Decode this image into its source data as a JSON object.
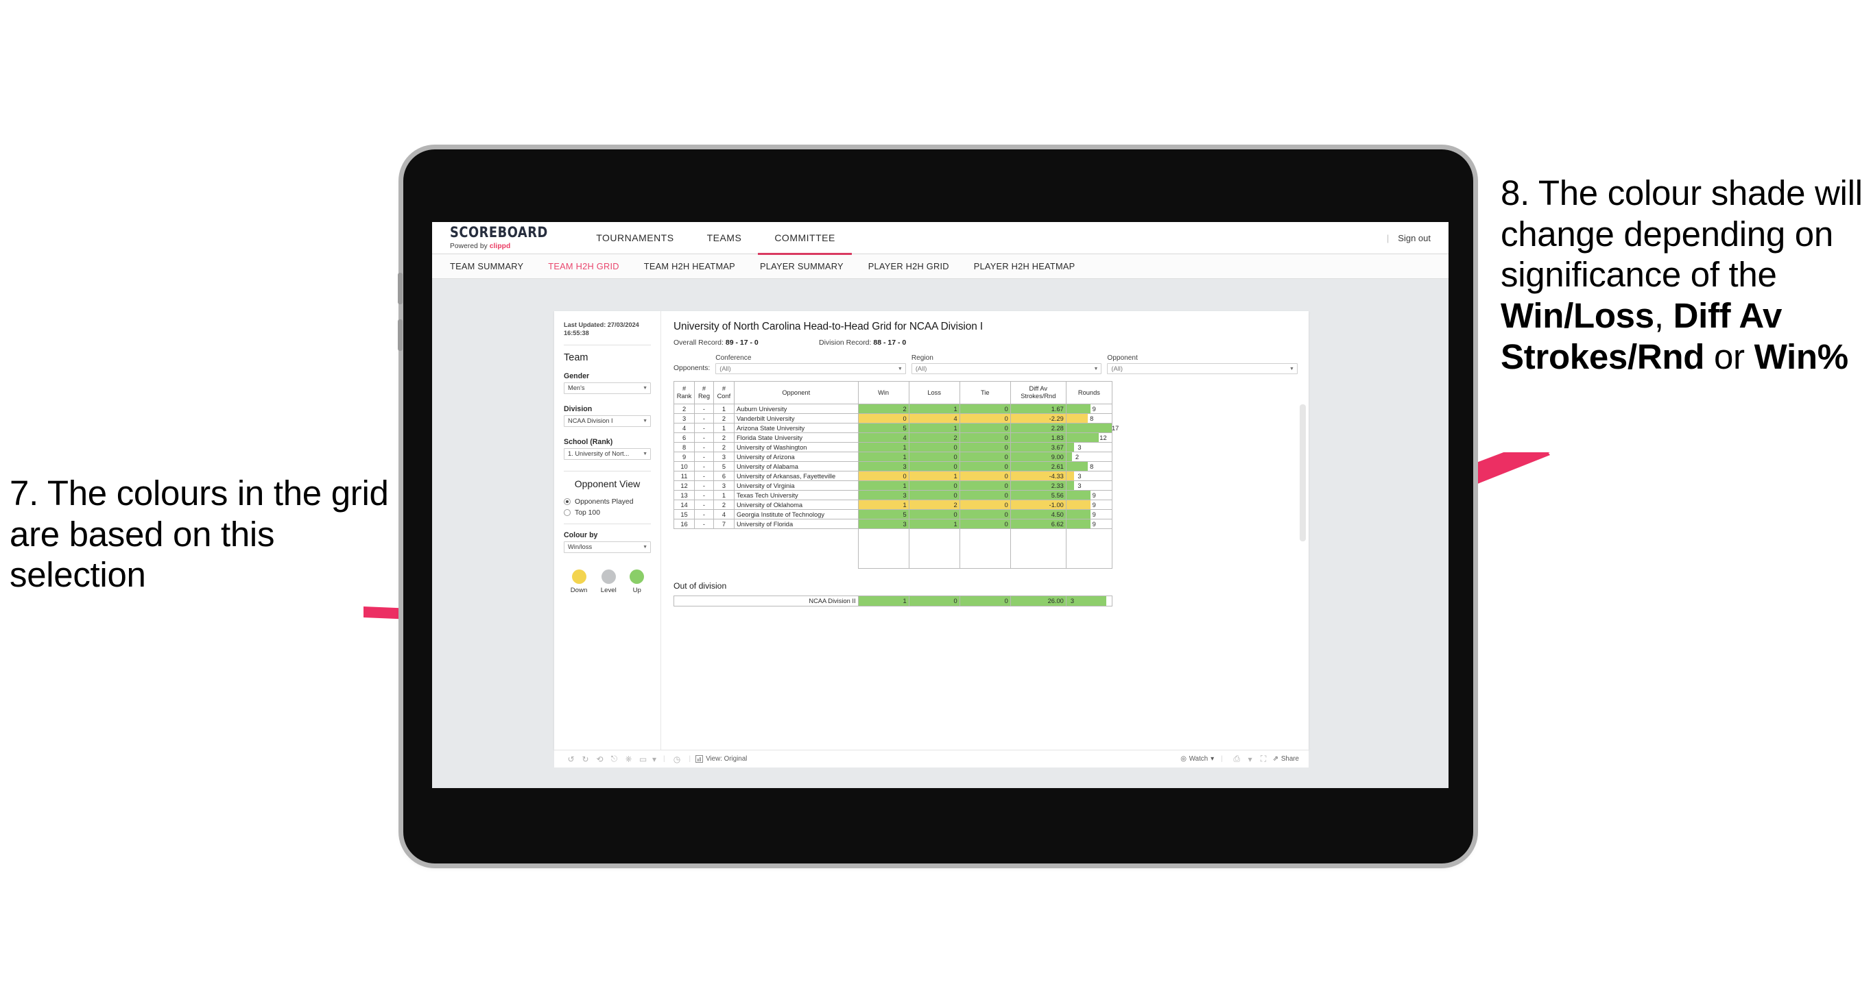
{
  "annotations": {
    "left": {
      "number": "7.",
      "text": "7. The colours in the grid are based on this selection"
    },
    "right": {
      "segments": [
        {
          "text": "8. The colour shade will change depending on significance of the ",
          "bold": false
        },
        {
          "text": "Win/Loss",
          "bold": true
        },
        {
          "text": ", ",
          "bold": false
        },
        {
          "text": "Diff Av Strokes/Rnd",
          "bold": true
        },
        {
          "text": " or ",
          "bold": false
        },
        {
          "text": "Win%",
          "bold": true
        }
      ]
    },
    "arrow_color": "#ec2f63"
  },
  "app": {
    "brand": {
      "title": "SCOREBOARD",
      "powered_prefix": "Powered by ",
      "powered_name": "clippd"
    },
    "topnav": [
      {
        "label": "TOURNAMENTS",
        "active": false
      },
      {
        "label": "TEAMS",
        "active": false
      },
      {
        "label": "COMMITTEE",
        "active": true
      }
    ],
    "signout": {
      "divider": "|",
      "label": "Sign out"
    },
    "subnav": [
      {
        "label": "TEAM SUMMARY",
        "active": false
      },
      {
        "label": "TEAM H2H GRID",
        "active": true
      },
      {
        "label": "TEAM H2H HEATMAP",
        "active": false
      },
      {
        "label": "PLAYER SUMMARY",
        "active": false
      },
      {
        "label": "PLAYER H2H GRID",
        "active": false
      },
      {
        "label": "PLAYER H2H HEATMAP",
        "active": false
      }
    ],
    "accent_color": "#e9476e"
  },
  "filters": {
    "last_updated": "Last Updated: 27/03/2024 16:55:38",
    "team_heading": "Team",
    "gender": {
      "label": "Gender",
      "value": "Men's"
    },
    "division": {
      "label": "Division",
      "value": "NCAA Division I"
    },
    "school": {
      "label": "School (Rank)",
      "value": "1. University of Nort..."
    },
    "opponent_view": {
      "heading": "Opponent View",
      "options": [
        {
          "label": "Opponents Played",
          "selected": true
        },
        {
          "label": "Top 100",
          "selected": false
        }
      ]
    },
    "colour_by": {
      "label": "Colour by",
      "value": "Win/loss"
    },
    "legend": [
      {
        "label": "Down",
        "color": "#f3d44f"
      },
      {
        "label": "Level",
        "color": "#c2c4c6"
      },
      {
        "label": "Up",
        "color": "#8ace68"
      }
    ]
  },
  "viz": {
    "title": "University of North Carolina Head-to-Head Grid for NCAA Division I",
    "overall_record_label": "Overall Record: ",
    "overall_record_value": "89 - 17 - 0",
    "division_record_label": "Division Record: ",
    "division_record_value": "88 - 17 - 0",
    "opponents_label": "Opponents:",
    "opponent_filters": [
      {
        "label": "Conference",
        "value": "(All)"
      },
      {
        "label": "Region",
        "value": "(All)"
      },
      {
        "label": "Opponent",
        "value": "(All)"
      }
    ],
    "out_of_division_title": "Out of division",
    "out_of_division_row": {
      "name": "NCAA Division II",
      "win": "1",
      "loss": "0",
      "tie": "0",
      "diff": "26.00",
      "rounds": "3",
      "state": "up",
      "rounds_pct": 88
    }
  },
  "chart_data": {
    "type": "table",
    "title": "University of North Carolina Head-to-Head Grid for NCAA Division I",
    "columns": [
      "# Rank",
      "# Reg",
      "# Conf",
      "Opponent",
      "Win",
      "Loss",
      "Tie",
      "Diff Av Strokes/Rnd",
      "Rounds"
    ],
    "colour_by": "Win/loss",
    "colour_scale": {
      "down": "#f5d55d",
      "level": "#c2c4c6",
      "up": "#8ece6c"
    },
    "rounds_axis_max": 17,
    "rows": [
      {
        "rank": "2",
        "reg": "-",
        "conf": "1",
        "opponent": "Auburn University",
        "win": "2",
        "loss": "1",
        "tie": "0",
        "diff": "1.67",
        "rounds": "9",
        "state": "up"
      },
      {
        "rank": "3",
        "reg": "-",
        "conf": "2",
        "opponent": "Vanderbilt University",
        "win": "0",
        "loss": "4",
        "tie": "0",
        "diff": "-2.29",
        "rounds": "8",
        "state": "down"
      },
      {
        "rank": "4",
        "reg": "-",
        "conf": "1",
        "opponent": "Arizona State University",
        "win": "5",
        "loss": "1",
        "tie": "0",
        "diff": "2.28",
        "rounds": "17",
        "state": "up"
      },
      {
        "rank": "6",
        "reg": "-",
        "conf": "2",
        "opponent": "Florida State University",
        "win": "4",
        "loss": "2",
        "tie": "0",
        "diff": "1.83",
        "rounds": "12",
        "state": "up"
      },
      {
        "rank": "8",
        "reg": "-",
        "conf": "2",
        "opponent": "University of Washington",
        "win": "1",
        "loss": "0",
        "tie": "0",
        "diff": "3.67",
        "rounds": "3",
        "state": "up"
      },
      {
        "rank": "9",
        "reg": "-",
        "conf": "3",
        "opponent": "University of Arizona",
        "win": "1",
        "loss": "0",
        "tie": "0",
        "diff": "9.00",
        "rounds": "2",
        "state": "up"
      },
      {
        "rank": "10",
        "reg": "-",
        "conf": "5",
        "opponent": "University of Alabama",
        "win": "3",
        "loss": "0",
        "tie": "0",
        "diff": "2.61",
        "rounds": "8",
        "state": "up"
      },
      {
        "rank": "11",
        "reg": "-",
        "conf": "6",
        "opponent": "University of Arkansas, Fayetteville",
        "win": "0",
        "loss": "1",
        "tie": "0",
        "diff": "-4.33",
        "rounds": "3",
        "state": "down"
      },
      {
        "rank": "12",
        "reg": "-",
        "conf": "3",
        "opponent": "University of Virginia",
        "win": "1",
        "loss": "0",
        "tie": "0",
        "diff": "2.33",
        "rounds": "3",
        "state": "up"
      },
      {
        "rank": "13",
        "reg": "-",
        "conf": "1",
        "opponent": "Texas Tech University",
        "win": "3",
        "loss": "0",
        "tie": "0",
        "diff": "5.56",
        "rounds": "9",
        "state": "up"
      },
      {
        "rank": "14",
        "reg": "-",
        "conf": "2",
        "opponent": "University of Oklahoma",
        "win": "1",
        "loss": "2",
        "tie": "0",
        "diff": "-1.00",
        "rounds": "9",
        "state": "down"
      },
      {
        "rank": "15",
        "reg": "-",
        "conf": "4",
        "opponent": "Georgia Institute of Technology",
        "win": "5",
        "loss": "0",
        "tie": "0",
        "diff": "4.50",
        "rounds": "9",
        "state": "up"
      },
      {
        "rank": "16",
        "reg": "-",
        "conf": "7",
        "opponent": "University of Florida",
        "win": "3",
        "loss": "1",
        "tie": "0",
        "diff": "6.62",
        "rounds": "9",
        "state": "up"
      }
    ]
  },
  "toolbar": {
    "view_label": "View: Original",
    "watch_label": "Watch",
    "share_label": "Share"
  }
}
